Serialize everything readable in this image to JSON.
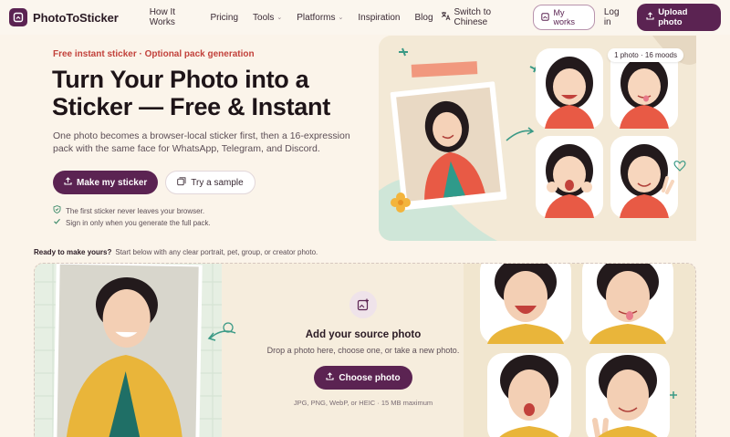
{
  "brand": {
    "name": "PhotoToSticker"
  },
  "nav": {
    "links": [
      {
        "label": "How It Works",
        "has_menu": false
      },
      {
        "label": "Pricing",
        "has_menu": false
      },
      {
        "label": "Tools",
        "has_menu": true
      },
      {
        "label": "Platforms",
        "has_menu": true
      },
      {
        "label": "Inspiration",
        "has_menu": false
      },
      {
        "label": "Blog",
        "has_menu": false
      }
    ],
    "language_switch": "Switch to Chinese",
    "my_works": "My works",
    "login": "Log in",
    "upload": "Upload photo"
  },
  "hero": {
    "eyebrow": "Free instant sticker · Optional pack generation",
    "title": "Turn Your Photo into a Sticker — Free & Instant",
    "subtitle": "One photo becomes a browser-local sticker first, then a 16-expression pack with the same face for WhatsApp, Telegram, and Discord.",
    "primary_cta": "Make my sticker",
    "secondary_cta": "Try a sample",
    "checks": [
      "The first sticker never leaves your browser.",
      "Sign in only when you generate the full pack."
    ],
    "badge": "1 photo · 16 moods"
  },
  "ready": {
    "bold": "Ready to make yours?",
    "text": "Start below with any clear portrait, pet, group, or creator photo."
  },
  "dropzone": {
    "title": "Add your source photo",
    "subtitle": "Drop a photo here, choose one, or take a new photo.",
    "button": "Choose photo",
    "formats": "JPG, PNG, WebP, or HEIC · 15 MB maximum"
  },
  "colors": {
    "brand": "#5b2352",
    "accent_red": "#c2413b",
    "background": "#fbf4ea"
  }
}
